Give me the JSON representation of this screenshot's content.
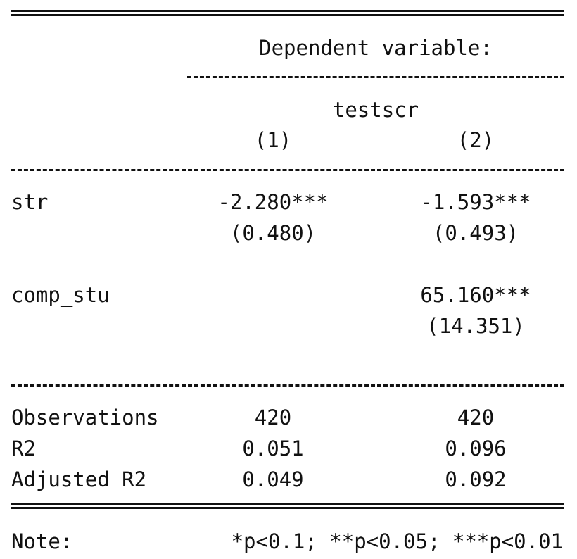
{
  "header": {
    "dependent_variable_label": "Dependent variable:",
    "dependent_variable_name": "testscr",
    "columns": [
      "(1)",
      "(2)"
    ]
  },
  "coefficients": [
    {
      "name": "str",
      "estimates": [
        "-2.280***",
        "-1.593***"
      ],
      "std_errors": [
        "(0.480)",
        "(0.493)"
      ]
    },
    {
      "name": "comp_stu",
      "estimates": [
        "",
        "65.160***"
      ],
      "std_errors": [
        "",
        "(14.351)"
      ]
    }
  ],
  "stats": [
    {
      "name": "Observations",
      "values": [
        "420",
        "420"
      ]
    },
    {
      "name": "R2",
      "values": [
        "0.051",
        "0.096"
      ]
    },
    {
      "name": "Adjusted R2",
      "values": [
        "0.049",
        "0.092"
      ]
    }
  ],
  "note": {
    "label": "Note:",
    "text": "*p<0.1; **p<0.05; ***p<0.01"
  }
}
